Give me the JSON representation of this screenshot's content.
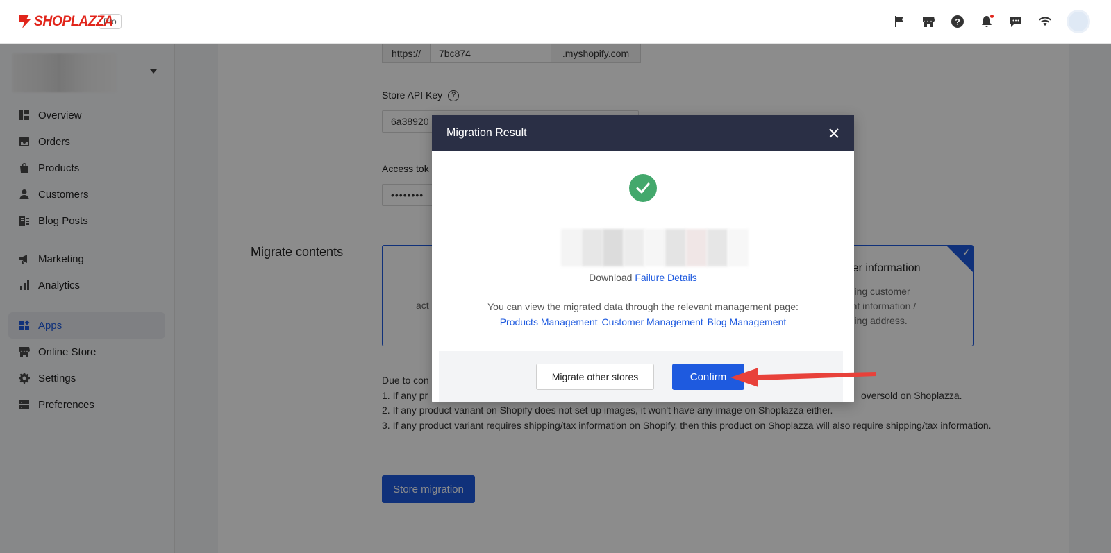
{
  "header": {
    "brand": "SHOPLAZZA",
    "plan_badge": "Pro",
    "icons": [
      "flag-icon",
      "store-icon",
      "help-icon",
      "bell-icon",
      "message-icon",
      "wifi-icon"
    ]
  },
  "sidebar": {
    "items": [
      {
        "label": "Overview",
        "icon": "overview-icon"
      },
      {
        "label": "Orders",
        "icon": "orders-icon"
      },
      {
        "label": "Products",
        "icon": "products-icon"
      },
      {
        "label": "Customers",
        "icon": "customers-icon"
      },
      {
        "label": "Blog Posts",
        "icon": "blog-icon"
      },
      {
        "label": "Marketing",
        "icon": "megaphone-icon"
      },
      {
        "label": "Analytics",
        "icon": "analytics-icon"
      },
      {
        "label": "Apps",
        "icon": "apps-icon",
        "active": true
      },
      {
        "label": "Online Store",
        "icon": "store-icon"
      },
      {
        "label": "Settings",
        "icon": "gear-icon"
      },
      {
        "label": "Preferences",
        "icon": "preferences-icon"
      }
    ]
  },
  "form": {
    "url_prefix": "https://",
    "url_value": "7bc874",
    "url_suffix": ".myshopify.com",
    "api_key_label": "Store API Key",
    "api_key_value": "6a38920",
    "access_token_label": "Access tok",
    "access_token_value": "••••••••",
    "migrate_title": "Migrate contents",
    "left_option_desc_fragment": "act",
    "right_option_title_fragment": "stomer information",
    "right_option_desc_lines": [
      "ncluding customer",
      "ccount information /",
      "shipping address."
    ],
    "notes": [
      "Due to con",
      "1. If any pr",
      "oversold on Shoplazza.",
      "2. If any product variant on Shopify does not set up images, it won't have any image on Shoplazza either.",
      "3. If any product variant requires shipping/tax information on Shopify, then this product on Shoplazza will also require shipping/tax information."
    ],
    "submit_label": "Store migration"
  },
  "modal": {
    "title": "Migration Result",
    "download_prefix": "Download",
    "download_link": "Failure Details",
    "info_text": "You can view the migrated data through the relevant management page:",
    "links": [
      "Products Management",
      "Customer Management",
      "Blog Management"
    ],
    "secondary_button": "Migrate other stores",
    "confirm_button": "Confirm"
  },
  "colors": {
    "accent": "#1e5adf",
    "brand": "#e1251b",
    "modal_header": "#2a2f45",
    "success": "#43a86c",
    "annotation_arrow": "#e8413a"
  }
}
